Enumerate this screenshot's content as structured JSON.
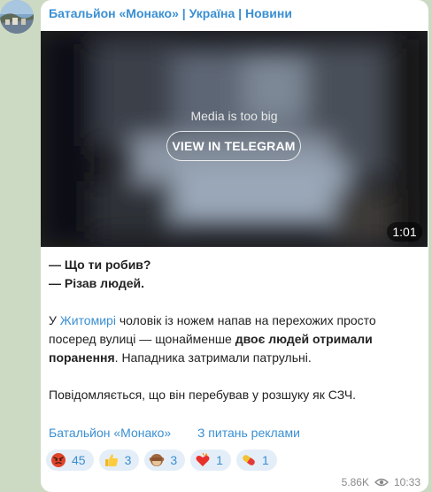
{
  "post": {
    "channel_title": "Батальйон «Монако» | Україна | Новини",
    "media": {
      "status_text": "Media is too big",
      "button_label": "VIEW IN TELEGRAM",
      "duration": "1:01"
    },
    "text": {
      "line1": "— Що ти робив?",
      "line2": "— Різав людей.",
      "p2_pre": "У ",
      "p2_link": "Житомирі",
      "p2_mid": " чоловік із ножем напав на перехожих просто посеред вулиці — щонайменше ",
      "p2_bold": "двоє людей отримали поранення",
      "p2_post": ". Нападника затримали патрульні.",
      "p3": "Повідомляється, що він перебував у розшуку як СЗЧ."
    },
    "footer": {
      "link1": "Батальйон «Монако»",
      "link2": "З питань реклами"
    },
    "reactions": [
      {
        "icon": "angry-face-icon",
        "count": "45"
      },
      {
        "icon": "thumbs-up-icon",
        "count": "3"
      },
      {
        "icon": "see-no-evil-monkey-icon",
        "count": "3"
      },
      {
        "icon": "heart-on-fire-icon",
        "count": "1"
      },
      {
        "icon": "pill-icon",
        "count": "1"
      }
    ],
    "views": "5.86K",
    "time": "10:33",
    "colors": {
      "accent": "#3a8fd2",
      "background": "#ccd9c3",
      "reaction_bg": "#e4eef8"
    }
  }
}
